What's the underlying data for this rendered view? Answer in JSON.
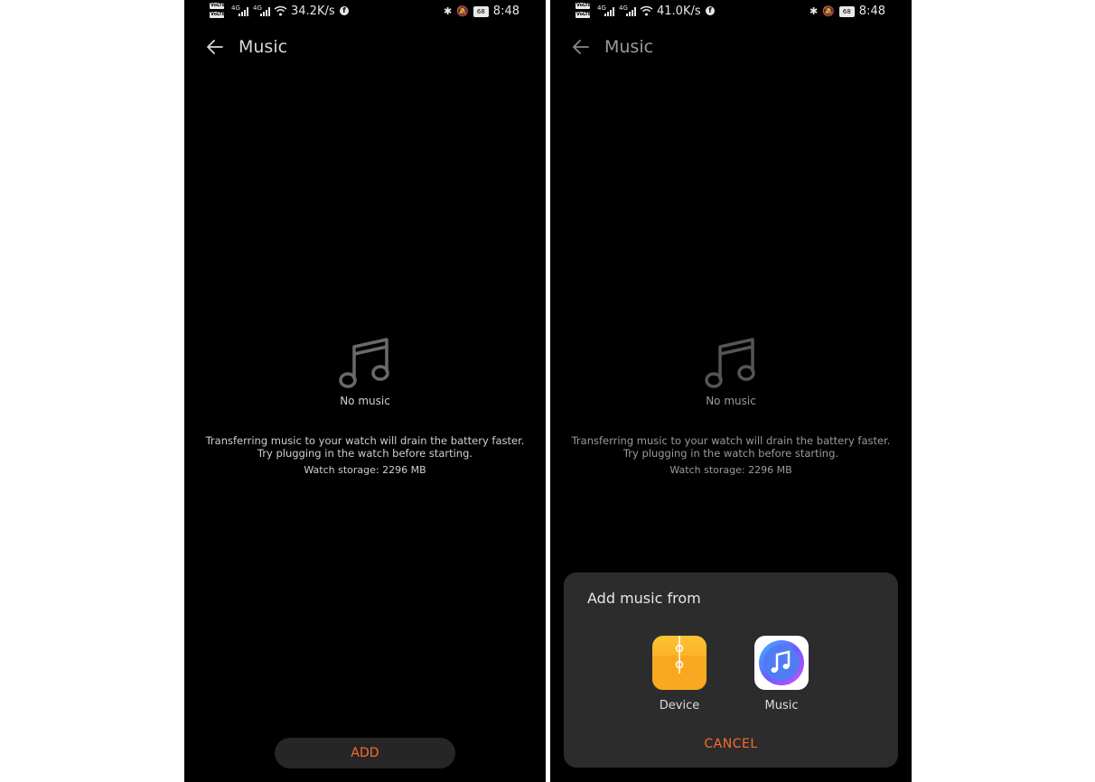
{
  "screens": [
    {
      "status": {
        "sim1": "VoLTE",
        "sim2": "VoLTE",
        "net1": "4G",
        "net2": "4G",
        "speed": "34.2K/s",
        "battery": "68",
        "time": "8:48"
      },
      "header": {
        "title": "Music"
      },
      "empty": {
        "label": "No music"
      },
      "hint": "Transferring music to your watch will drain the battery faster. Try plugging in the watch before starting.",
      "storage": "Watch storage: 2296 MB",
      "add_label": "ADD"
    },
    {
      "status": {
        "sim1": "VoLTE",
        "sim2": "VoLTE",
        "net1": "4G",
        "net2": "4G",
        "speed": "41.0K/s",
        "battery": "68",
        "time": "8:48"
      },
      "header": {
        "title": "Music"
      },
      "empty": {
        "label": "No music"
      },
      "hint": "Transferring music to your watch will drain the battery faster. Try plugging in the watch before starting.",
      "storage": "Watch storage: 2296 MB",
      "dialog": {
        "title": "Add music from",
        "options": [
          {
            "label": "Device",
            "icon": "files-folder-icon"
          },
          {
            "label": "Music",
            "icon": "music-app-icon"
          }
        ],
        "cancel_label": "CANCEL"
      }
    }
  ],
  "colors": {
    "background": "#000000",
    "accent": "#ff6a2a",
    "dialog": "#2c2c2c",
    "button": "#262626"
  }
}
